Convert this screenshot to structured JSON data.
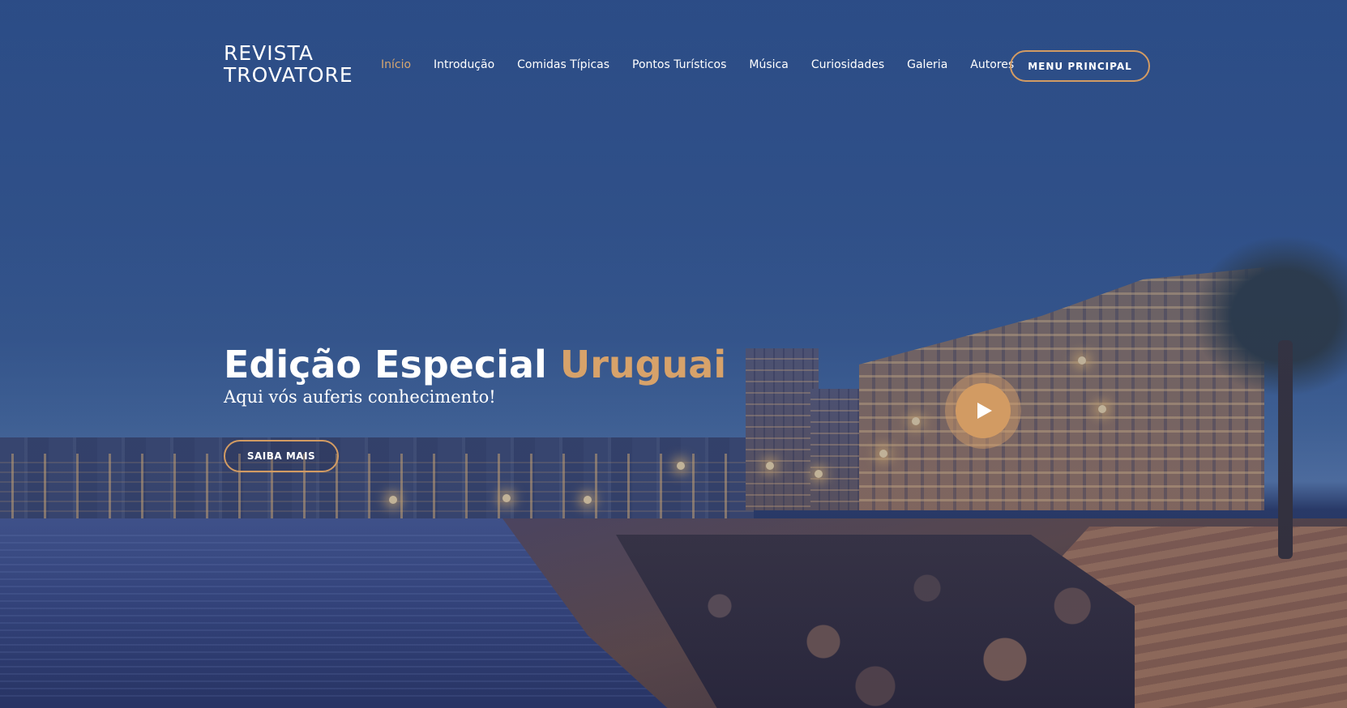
{
  "brand": {
    "line1": "REVISTA",
    "line2": "TROVATORE"
  },
  "nav": {
    "items": [
      {
        "label": "Início",
        "active": true
      },
      {
        "label": "Introdução"
      },
      {
        "label": "Comidas Típicas"
      },
      {
        "label": "Pontos Turísticos"
      },
      {
        "label": "Música"
      },
      {
        "label": "Curiosidades"
      },
      {
        "label": "Galeria"
      },
      {
        "label": "Autores"
      }
    ],
    "menu_button": "MENU PRINCIPAL"
  },
  "hero": {
    "title_main": "Edição Especial",
    "title_accent": "Uruguai",
    "subtitle": "Aqui vós auferis conhecimento!",
    "cta_label": "SAIBA MAIS",
    "play_icon": "play-icon"
  },
  "colors": {
    "accent": "#d29b63",
    "background": "#2e5089",
    "text": "#ffffff"
  }
}
